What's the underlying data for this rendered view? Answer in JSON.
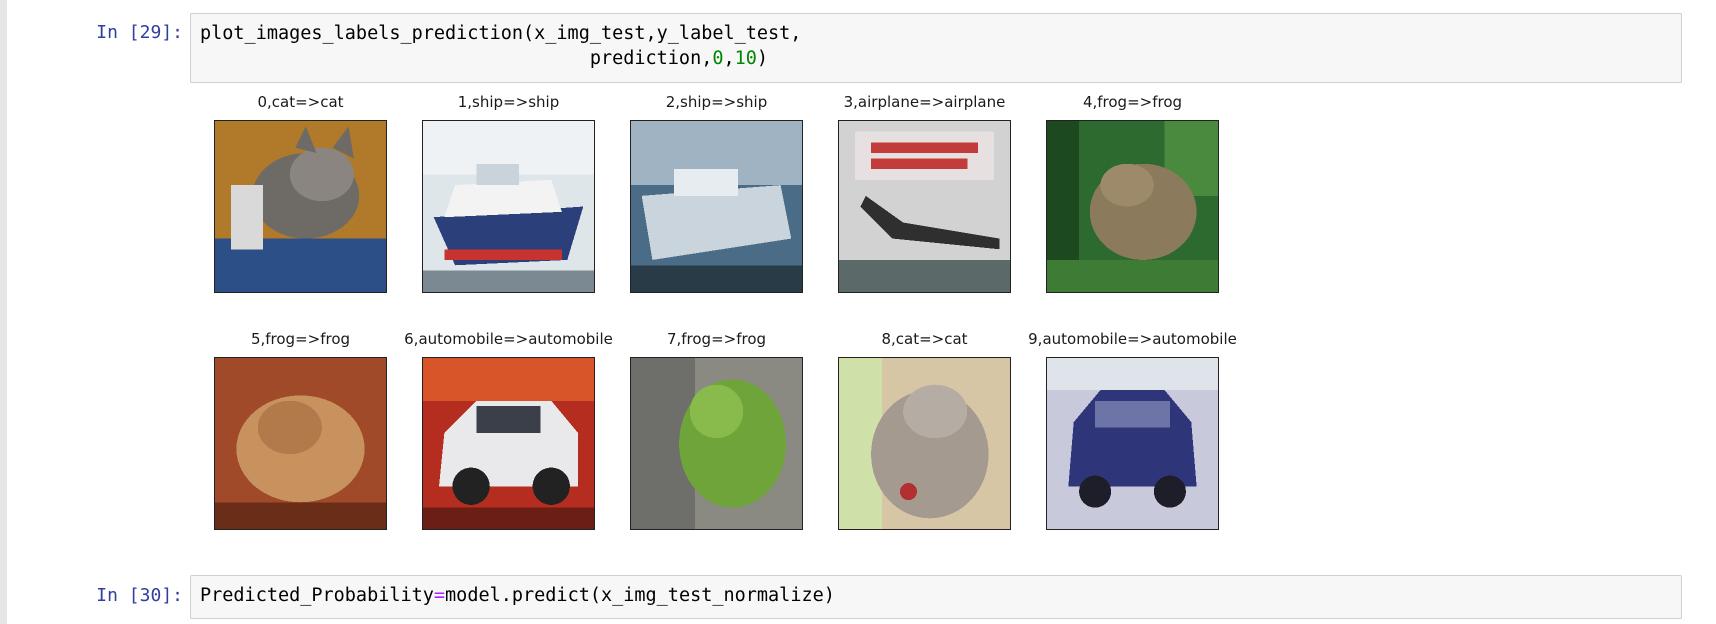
{
  "cells": [
    {
      "prompt": "In [29]:",
      "code_lines": [
        [
          {
            "t": "plot_images_labels_prediction(x_img_test,y_label_test,"
          }
        ],
        [
          {
            "t": "                                   prediction,"
          },
          {
            "t": "0",
            "c": "num"
          },
          {
            "t": ","
          },
          {
            "t": "10",
            "c": "num"
          },
          {
            "t": ")"
          }
        ]
      ]
    },
    {
      "prompt": "In [30]:",
      "code_lines": [
        [
          {
            "t": "Predicted_Probability"
          },
          {
            "t": "=",
            "c": "op"
          },
          {
            "t": "model.predict(x_img_test_normalize)"
          }
        ]
      ]
    }
  ],
  "output_images": [
    {
      "title": "0,cat=>cat",
      "subject": "cat"
    },
    {
      "title": "1,ship=>ship",
      "subject": "ship"
    },
    {
      "title": "2,ship=>ship",
      "subject": "ship"
    },
    {
      "title": "3,airplane=>airplane",
      "subject": "airplane"
    },
    {
      "title": "4,frog=>frog",
      "subject": "frog"
    },
    {
      "title": "5,frog=>frog",
      "subject": "frog"
    },
    {
      "title": "6,automobile=>automobile",
      "subject": "automobile"
    },
    {
      "title": "7,frog=>frog",
      "subject": "frog"
    },
    {
      "title": "8,cat=>cat",
      "subject": "cat"
    },
    {
      "title": "9,automobile=>automobile",
      "subject": "automobile"
    }
  ],
  "colors": {
    "prompt": "#303f9f",
    "number": "#008800",
    "operator": "#aa22ff",
    "cell_bg": "#f7f7f7",
    "cell_border": "#cfcfcf"
  }
}
